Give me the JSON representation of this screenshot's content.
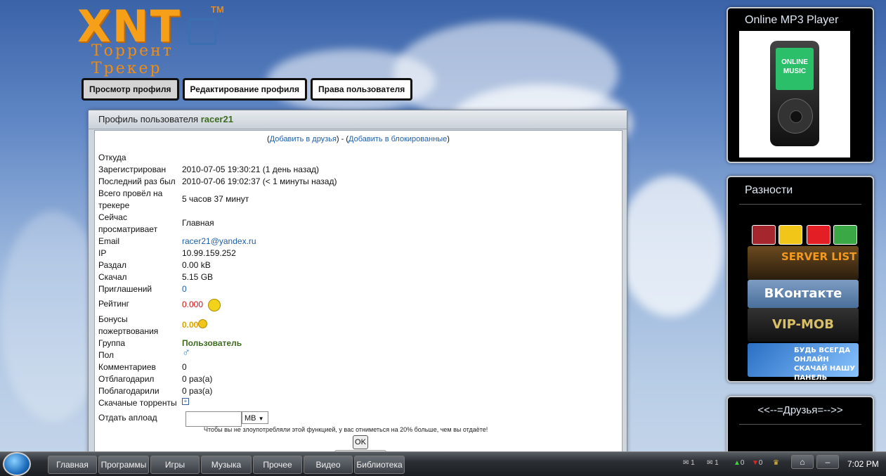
{
  "logo": {
    "main": "XNT",
    "tm": "TM",
    "sub": "Торрент Трекер"
  },
  "tabs": [
    "Просмотр профиля",
    "Редактирование профиля",
    "Права пользователя"
  ],
  "profile": {
    "title_prefix": "Профиль пользователя",
    "username": "racer21",
    "actions": {
      "open1": "(",
      "add_friend": "Добавить в друзья",
      "close1": ")",
      "sep": " - ",
      "open2": "(",
      "add_block": "Добавить в блокированные",
      "close2": ")"
    },
    "rows": [
      {
        "label": "Откуда",
        "value": ""
      },
      {
        "label": "Зарегистрирован",
        "value": "2010-07-05 19:30:21 (1 день назад)"
      },
      {
        "label": "Последний раз был",
        "value": "2010-07-06 19:02:37 (< 1 минуты назад)"
      },
      {
        "label": "Всего провёл на трекере",
        "value": "5 часов 37 минут"
      },
      {
        "label": "Сейчас просматривает",
        "value": "Главная"
      },
      {
        "label": "Email",
        "value": "racer21@yandex.ru"
      },
      {
        "label": "IP",
        "value": "10.99.159.252"
      },
      {
        "label": "Раздал",
        "value": "0.00 kB"
      },
      {
        "label": "Скачал",
        "value": "5.15 GB"
      },
      {
        "label": "Приглашений",
        "value": "0"
      },
      {
        "label": "Рейтинг",
        "value": "0.000"
      },
      {
        "label": "Бонусы пожертвования",
        "value": "0.00"
      },
      {
        "label": "Группа",
        "value": "Пользователь"
      },
      {
        "label": "Пол",
        "value": "♂"
      },
      {
        "label": "Комментариев",
        "value": "0"
      },
      {
        "label": "Отблагодарил",
        "value": "0 раз(а)"
      },
      {
        "label": "Поблагодарили",
        "value": "0 раз(а)"
      },
      {
        "label": "Скачаные торренты",
        "value": "+"
      },
      {
        "label": "Отдать аплоад",
        "value": ""
      }
    ],
    "upload_unit": "MB",
    "upload_note": "Чтобы вы не злоупотребляли этой функцией, у вас отниметься на 20% больше, чем вы отдаёте!",
    "ok_label": "OK"
  },
  "sidebar": {
    "player_title": "Online MP3 Player",
    "player_screen": "ONLINE MUSIC",
    "misc_title": "Разности",
    "banners": [
      {
        "text": "SERVER LIST",
        "color": "#e58a1e"
      },
      {
        "text": "ВКонтакте",
        "color": "#5b7fa6"
      },
      {
        "text": "VIP-MOB",
        "color": "#d9c066"
      },
      {
        "text": "БУДЬ ВСЕГДА ОНЛАЙН СКАЧАЙ НАШУ ПАНЕЛЬ",
        "color": "#2a6fc4"
      }
    ],
    "friends_title": "<<--=Друзья=-->>"
  },
  "taskbar": {
    "buttons": [
      "Главная",
      "Программы",
      "Игры",
      "Музыка",
      "Прочее",
      "Видео",
      "Библиотека"
    ],
    "tray": [
      "1",
      "1",
      "0",
      "0"
    ],
    "clock": "7:02 PM"
  },
  "colors": {
    "accent": "#1f5fa8",
    "group": "#3d6b1f",
    "rating": "#cc1111",
    "bonus": "#d9a400"
  }
}
